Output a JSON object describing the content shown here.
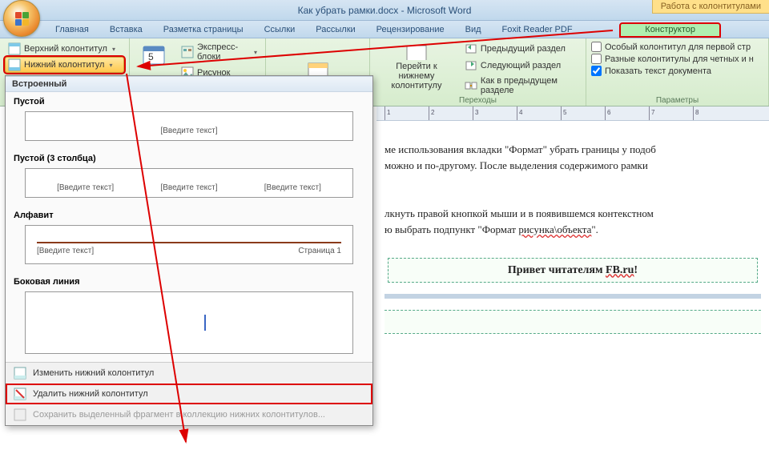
{
  "title": "Как убрать рамки.docx - Microsoft Word",
  "context_tab_group": "Работа с колонтитулами",
  "tabs": {
    "home": "Главная",
    "insert": "Вставка",
    "layout": "Разметка страницы",
    "references": "Ссылки",
    "mailings": "Рассылки",
    "review": "Рецензирование",
    "view": "Вид",
    "foxit": "Foxit Reader PDF",
    "designer": "Конструктор"
  },
  "ribbon": {
    "header_btn": "Верхний колонтитул",
    "footer_btn": "Нижний колонтитул",
    "quick_parts": "Экспресс-блоки",
    "picture": "Рисунок",
    "goto_footer": "Перейти к нижнему\nколонтитулу",
    "prev_section": "Предыдущий раздел",
    "next_section": "Следующий раздел",
    "link_prev": "Как в предыдущем разделе",
    "transitions_group": "Переходы",
    "diff_first": "Особый колонтитул для первой стр",
    "diff_oddeven": "Разные колонтитулы для четных и н",
    "show_doc": "Показать текст документа",
    "params_group": "Параметры"
  },
  "gallery": {
    "builtin": "Встроенный",
    "blank": "Пустой",
    "blank3": "Пустой (3 столбца)",
    "alphabet": "Алфавит",
    "sideline": "Боковая линия",
    "placeholder": "[Введите текст]",
    "page_label": "Страница 1",
    "edit_footer": "Изменить нижний колонтитул",
    "remove_footer": "Удалить нижний колонтитул",
    "save_selection": "Сохранить выделенный фрагмент в коллекцию нижних колонтитулов..."
  },
  "ruler": {
    "n1": "1",
    "n2": "2",
    "n3": "3",
    "n4": "4",
    "n5": "5",
    "n6": "6",
    "n7": "7",
    "n8": "8"
  },
  "doc": {
    "p1a": "ме использования вкладки \"Формат\" убрать границы у подоб",
    "p1b": "можно и по-другому. После выделения содержимого рамки",
    "p2a": "лкнуть правой кнопкой мыши и в появившемся контекстном",
    "p2b": "ю выбрать подпункт \"Формат ",
    "p2c": "рисунка\\объекта",
    "p2d": "\".",
    "footer_a": "Привет читателям ",
    "footer_b": "FB.ru",
    "footer_c": "!"
  }
}
